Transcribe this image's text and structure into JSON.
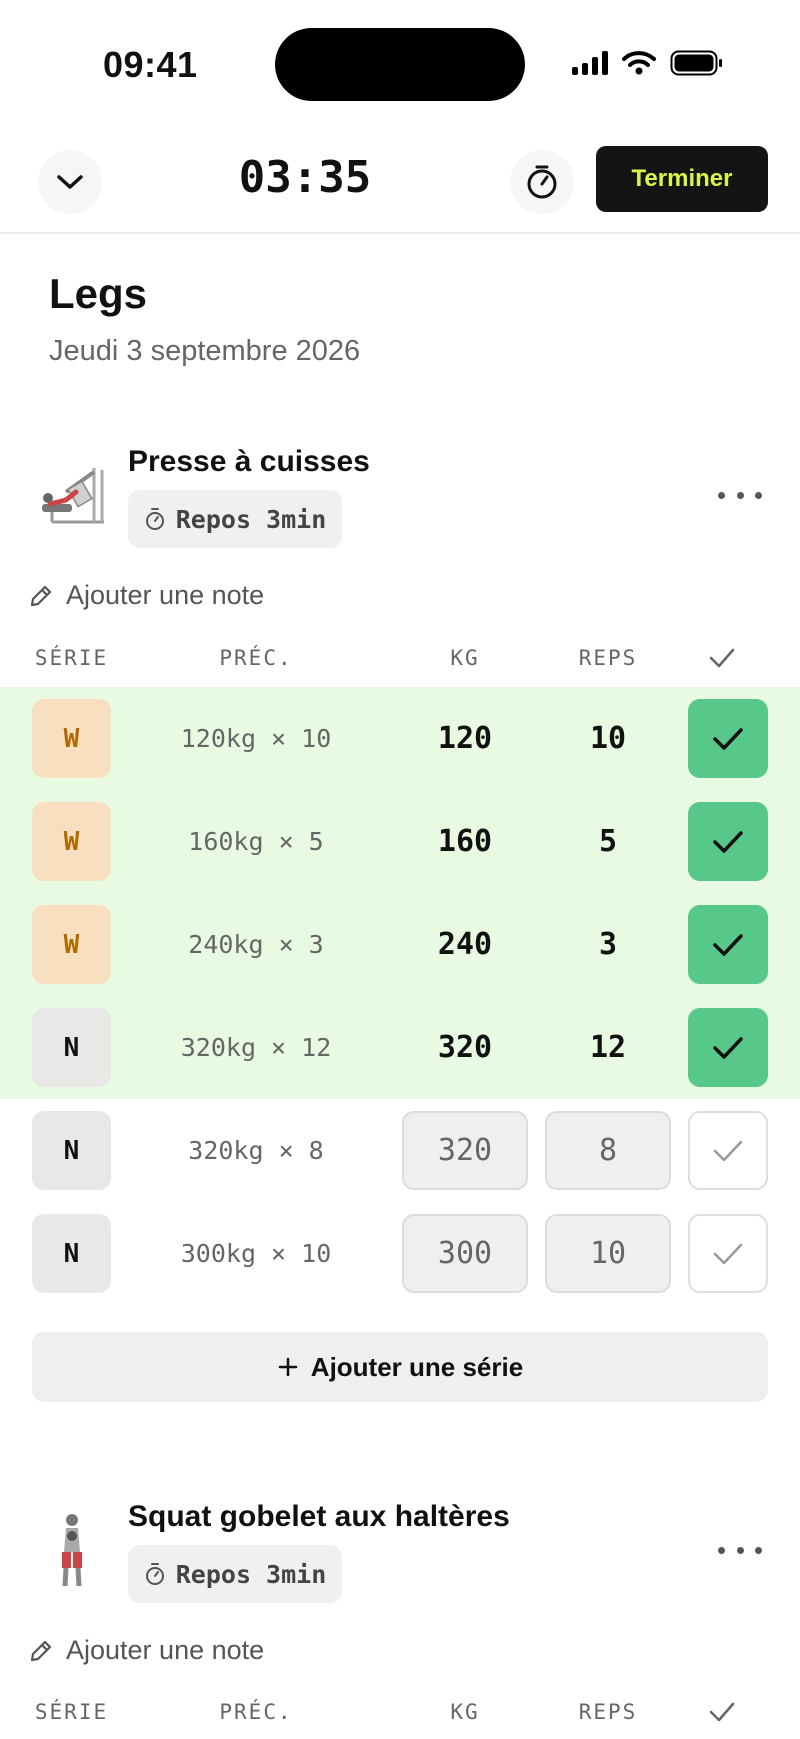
{
  "status_bar": {
    "time": "09:41"
  },
  "header": {
    "timer": "03:35",
    "finish_label": "Terminer"
  },
  "workout": {
    "title": "Legs",
    "date": "Jeudi 3 septembre 2026"
  },
  "columns": {
    "set": "SÉRIE",
    "prev": "PRÉC.",
    "kg": "KG",
    "reps": "REPS"
  },
  "exercises": [
    {
      "name": "Presse à cuisses",
      "rest": "Repos 3min",
      "add_note": "Ajouter une note",
      "sets": [
        {
          "type": "W",
          "prev": "120kg × 10",
          "kg": "120",
          "reps": "10",
          "done": true
        },
        {
          "type": "W",
          "prev": "160kg × 5",
          "kg": "160",
          "reps": "5",
          "done": true
        },
        {
          "type": "W",
          "prev": "240kg × 3",
          "kg": "240",
          "reps": "3",
          "done": true
        },
        {
          "type": "N",
          "prev": "320kg × 12",
          "kg": "320",
          "reps": "12",
          "done": true
        },
        {
          "type": "N",
          "prev": "320kg × 8",
          "kg": "320",
          "reps": "8",
          "done": false
        },
        {
          "type": "N",
          "prev": "300kg × 10",
          "kg": "300",
          "reps": "10",
          "done": false
        }
      ],
      "add_set": "Ajouter une série"
    },
    {
      "name": "Squat gobelet aux haltères",
      "rest": "Repos 3min",
      "add_note": "Ajouter une note"
    }
  ],
  "colors": {
    "done_row": "#e8fbe2",
    "check_on": "#58c88a",
    "finish_text": "#d8f549",
    "warmup_badge": "#f7dfc0"
  }
}
